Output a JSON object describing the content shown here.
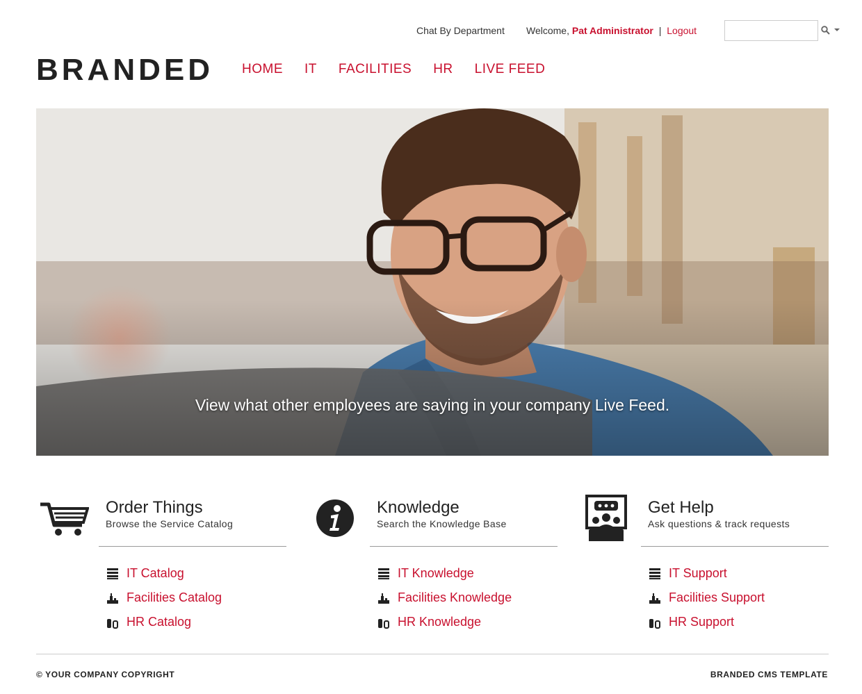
{
  "utility": {
    "chat_label": "Chat By Department",
    "welcome_prefix": "Welcome,",
    "user_name": "Pat Administrator",
    "separator": "|",
    "logout_label": "Logout",
    "search_value": ""
  },
  "header": {
    "logo": "BRANDED",
    "nav": [
      "HOME",
      "IT",
      "FACILITIES",
      "HR",
      "LIVE FEED"
    ]
  },
  "hero": {
    "caption": "View what other employees are saying in your company Live Feed."
  },
  "columns": [
    {
      "icon": "cart-icon",
      "title": "Order Things",
      "subtitle": "Browse the Service Catalog",
      "links": [
        "IT Catalog",
        "Facilities Catalog",
        "HR Catalog"
      ]
    },
    {
      "icon": "info-icon",
      "title": "Knowledge",
      "subtitle": "Search the Knowledge Base",
      "links": [
        "IT Knowledge",
        "Facilities Knowledge",
        "HR Knowledge"
      ]
    },
    {
      "icon": "help-desk-icon",
      "title": "Get Help",
      "subtitle": "Ask questions & track requests",
      "links": [
        "IT Support",
        "Facilities Support",
        "HR Support"
      ]
    }
  ],
  "footer": {
    "copyright": "© YOUR COMPANY COPYRIGHT",
    "template": "BRANDED CMS TEMPLATE"
  },
  "colors": {
    "accent": "#c8102e",
    "text": "#222222"
  }
}
